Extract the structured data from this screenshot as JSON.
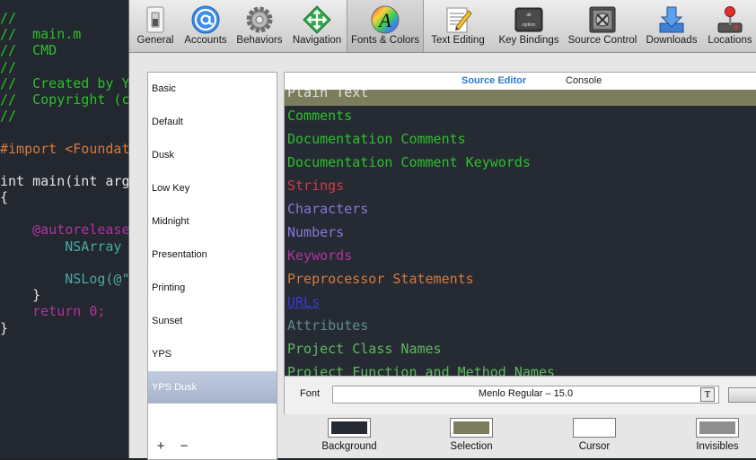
{
  "editor": {
    "lines": [
      {
        "text": "//",
        "color": "#2bc02b"
      },
      {
        "text": "//  main.m",
        "color": "#2bc02b"
      },
      {
        "text": "//  CMD",
        "color": "#2bc02b"
      },
      {
        "text": "//",
        "color": "#2bc02b"
      },
      {
        "text": "//  Created by Y",
        "color": "#2bc02b"
      },
      {
        "text": "//  Copyright (c",
        "color": "#2bc02b"
      },
      {
        "text": "//",
        "color": "#2bc02b"
      },
      {
        "text": "",
        "color": "#e6e6e6"
      },
      {
        "text": "#import <Foundat",
        "color": "#d77b3c"
      },
      {
        "text": "",
        "color": "#e6e6e6"
      },
      {
        "text": "int main(int arg",
        "color": "#e6e6e6"
      },
      {
        "text": "{",
        "color": "#e6e6e6"
      },
      {
        "text": "",
        "color": "#e6e6e6"
      },
      {
        "text": "    @autorelease",
        "color": "#b0349e"
      },
      {
        "text": "        NSArray ",
        "color": "#4aa9a3"
      },
      {
        "text": "",
        "color": "#e6e6e6"
      },
      {
        "text": "        NSLog(@\"",
        "color": "#4aa9a3"
      },
      {
        "text": "    }",
        "color": "#e6e6e6"
      },
      {
        "text": "    return 0;",
        "color": "#b0349e"
      },
      {
        "text": "}",
        "color": "#e6e6e6"
      }
    ]
  },
  "toolbar": {
    "items": [
      {
        "label": "General",
        "icon": "general-switch-icon"
      },
      {
        "label": "Accounts",
        "icon": "at-sign-icon"
      },
      {
        "label": "Behaviors",
        "icon": "gear-icon"
      },
      {
        "label": "Navigation",
        "icon": "navigation-arrows-icon"
      },
      {
        "label": "Fonts & Colors",
        "icon": "fonts-colors-icon"
      },
      {
        "label": "Text Editing",
        "icon": "text-editing-icon"
      },
      {
        "label": "Key Bindings",
        "icon": "option-key-icon"
      },
      {
        "label": "Source Control",
        "icon": "source-control-icon"
      },
      {
        "label": "Downloads",
        "icon": "downloads-icon"
      },
      {
        "label": "Locations",
        "icon": "locations-joystick-icon"
      }
    ],
    "selected": "Fonts & Colors"
  },
  "themes": {
    "items": [
      "Basic",
      "Default",
      "Dusk",
      "Low Key",
      "Midnight",
      "Presentation",
      "Printing",
      "Sunset",
      "YPS",
      "YPS Dusk"
    ],
    "selected": "YPS Dusk",
    "add_label": "+",
    "remove_label": "−"
  },
  "tabs": {
    "source_editor": "Source Editor",
    "console": "Console"
  },
  "syntax_items": [
    {
      "label": "Plain Text",
      "color": "#e0e0e0"
    },
    {
      "label": "Comments",
      "color": "#2bc02b"
    },
    {
      "label": "Documentation Comments",
      "color": "#2bc02b"
    },
    {
      "label": "Documentation Comment Keywords",
      "color": "#2bc02b"
    },
    {
      "label": "Strings",
      "color": "#d33a4a"
    },
    {
      "label": "Characters",
      "color": "#8b76d9"
    },
    {
      "label": "Numbers",
      "color": "#8b76d9"
    },
    {
      "label": "Keywords",
      "color": "#b0349e"
    },
    {
      "label": "Preprocessor Statements",
      "color": "#d77b3c"
    },
    {
      "label": "URLs",
      "color": "#3a3ad6"
    },
    {
      "label": "Attributes",
      "color": "#5e8a91"
    },
    {
      "label": "Project Class Names",
      "color": "#5fb95f"
    },
    {
      "label": "Project Function and Method Names",
      "color": "#5fb95f"
    }
  ],
  "font": {
    "label": "Font",
    "value": "Menlo Regular – 15.0"
  },
  "wells": [
    {
      "label": "Background",
      "color": "#262a33"
    },
    {
      "label": "Selection",
      "color": "#7b7d5c"
    },
    {
      "label": "Cursor",
      "color": "#ffffff"
    },
    {
      "label": "Invisibles",
      "color": "#8f8f8f"
    }
  ]
}
